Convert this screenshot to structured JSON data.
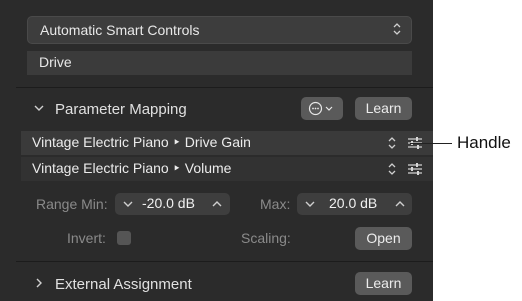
{
  "header": {
    "popup_label": "Automatic Smart Controls",
    "parameter_name": "Drive"
  },
  "parameter_mapping": {
    "title": "Parameter Mapping",
    "learn_label": "Learn",
    "rows": [
      {
        "label": "Vintage Electric Piano ‣ Drive Gain"
      },
      {
        "label": "Vintage Electric Piano ‣ Volume"
      }
    ]
  },
  "range": {
    "min_label": "Range Min:",
    "min_value": "-20.0 dB",
    "max_label": "Max:",
    "max_value": "20.0 dB",
    "invert_label": "Invert:",
    "scaling_label": "Scaling:",
    "open_label": "Open"
  },
  "external": {
    "title": "External Assignment",
    "learn_label": "Learn"
  },
  "callout": {
    "label": "Handle"
  },
  "colors": {
    "panel_bg": "#2b2b2b",
    "row_selected_bg": "#3a3a3a",
    "row_bg": "#323232",
    "button_bg": "#5a5a5a"
  }
}
